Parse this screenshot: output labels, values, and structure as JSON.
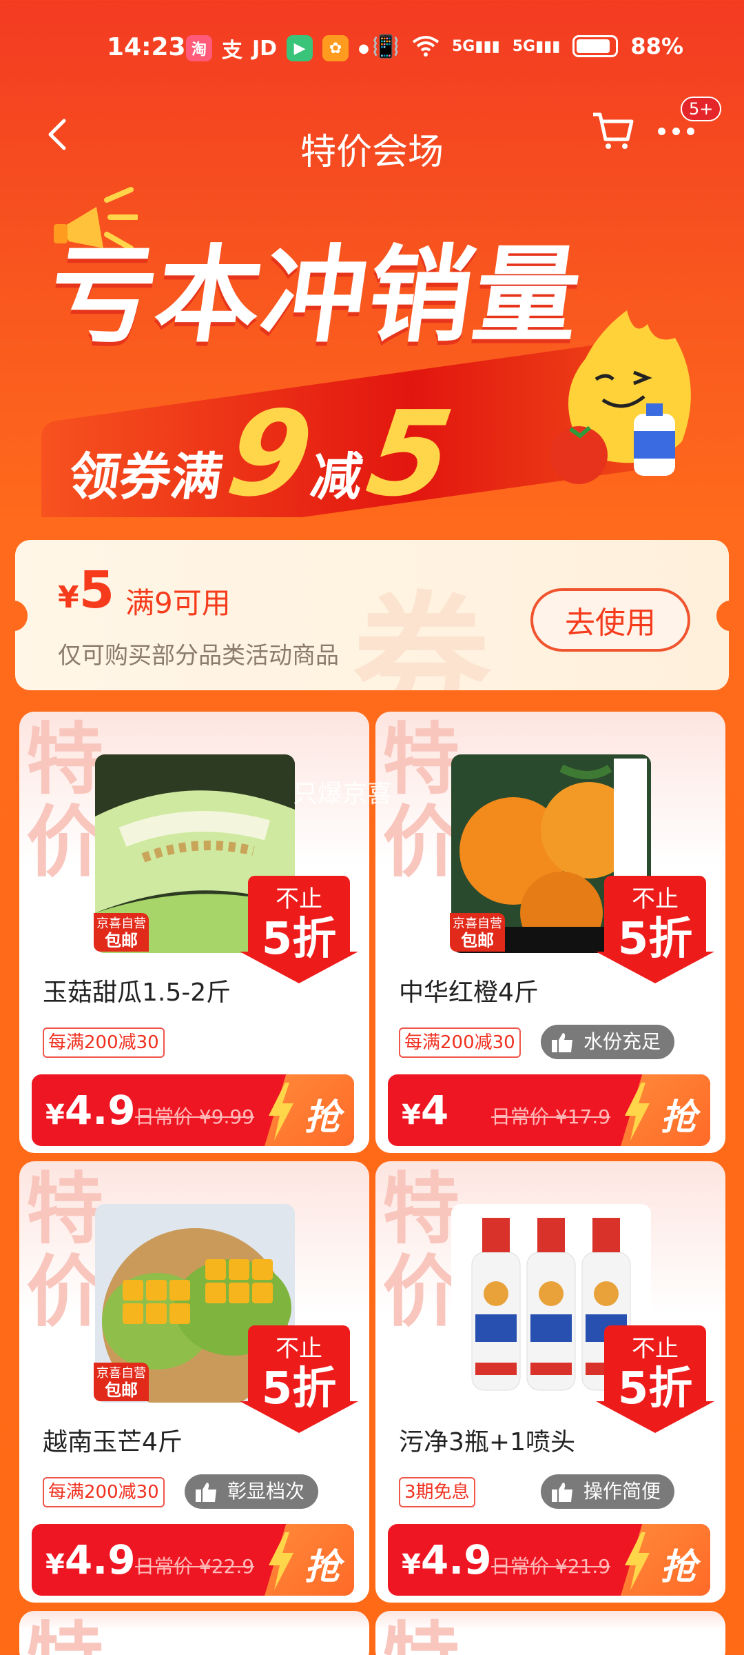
{
  "status_bar": {
    "time": "14:23",
    "apps": [
      "淘",
      "支",
      "JD"
    ],
    "net1": "5G",
    "net2": "5G",
    "battery": "88%",
    "battery_level": 0.88
  },
  "nav": {
    "title": "特价会场",
    "more_badge": "5+"
  },
  "hero": {
    "headline": "亏本冲销量",
    "sub_prefix": "领券满",
    "sub_num1": "9",
    "sub_mid": "减",
    "sub_num2": "5"
  },
  "coupon": {
    "currency": "¥",
    "amount": "5",
    "condition": "满9可用",
    "description": "仅可购买部分品类活动商品",
    "button": "去使用",
    "watermark": "券"
  },
  "overlay_text": "只爆京喜",
  "products": [
    {
      "name": "玉菇甜瓜1.5-2斤",
      "bg_text": "特价",
      "ship_line1": "京喜自营",
      "ship_line2": "包邮",
      "discount_line1": "不止",
      "discount_line2": "5折",
      "tag": "每满200减30",
      "hint": "",
      "currency": "¥",
      "price": "4.9",
      "orig": "日常价 ¥9.99",
      "grab": "抢"
    },
    {
      "name": "中华红橙4斤",
      "bg_text": "特价",
      "ship_line1": "京喜自营",
      "ship_line2": "包邮",
      "discount_line1": "不止",
      "discount_line2": "5折",
      "tag": "每满200减30",
      "hint": "水份充足",
      "currency": "¥",
      "price": "4",
      "orig": "日常价 ¥17.9",
      "grab": "抢"
    },
    {
      "name": "越南玉芒4斤",
      "bg_text": "特价",
      "ship_line1": "京喜自营",
      "ship_line2": "包邮",
      "discount_line1": "不止",
      "discount_line2": "5折",
      "tag": "每满200减30",
      "hint": "彰显档次",
      "currency": "¥",
      "price": "4.9",
      "orig": "日常价 ¥22.9",
      "grab": "抢"
    },
    {
      "name": "污净3瓶+1喷头",
      "bg_text": "特价",
      "ship_line1": "",
      "ship_line2": "",
      "discount_line1": "不止",
      "discount_line2": "5折",
      "tag": "3期免息",
      "hint": "操作简便",
      "currency": "¥",
      "price": "4.9",
      "orig": "日常价 ¥21.9",
      "grab": "抢"
    }
  ],
  "colors": {
    "accent": "#ee1622",
    "brand_orange": "#ff6a1c",
    "tag_red": "#f0301f"
  }
}
